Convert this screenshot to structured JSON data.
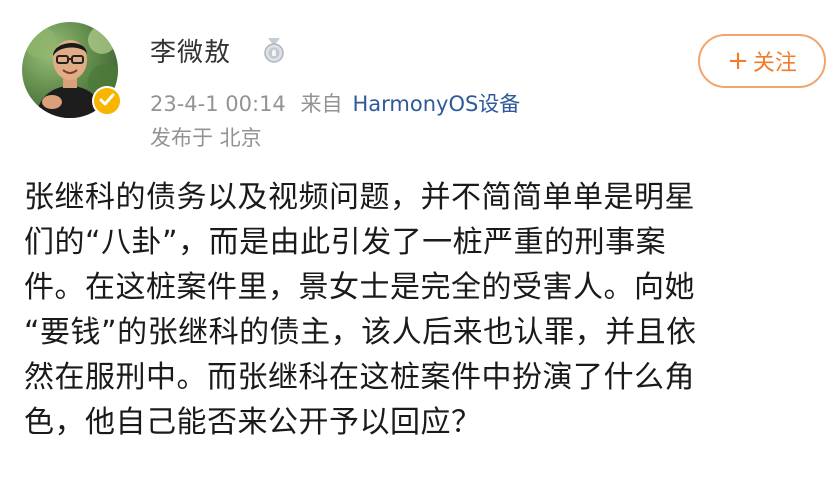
{
  "author": {
    "name": "李微敖",
    "timestamp": "23-4-1 00:14",
    "source_prefix": "来自",
    "device": "HarmonyOS设备",
    "location": "发布于 北京",
    "avatar_icon": "person-avatar",
    "verified_icon": "verified-badge-icon",
    "level_icon": "level-medal-icon"
  },
  "follow_button": {
    "plus": "+",
    "label": "关注"
  },
  "post": {
    "lines": [
      "张继科的债务以及视频问题，并不简简单单是明星",
      "们的“八卦”，而是由此引发了一桩严重的刑事案",
      "件。在这桩案件里，景女士是完全的受害人。向她",
      "“要钱”的张继科的债主，该人后来也认罪，并且依",
      "然在服刑中。而张继科在这桩案件中扮演了什么角",
      "色，他自己能否来公开予以回应？"
    ]
  },
  "colors": {
    "username": "#333333",
    "meta_gray": "#939393",
    "device_link": "#2f5a99",
    "follow_orange": "#f17c2c",
    "follow_border": "#f4a46e",
    "verified_gold": "#f7b500"
  }
}
